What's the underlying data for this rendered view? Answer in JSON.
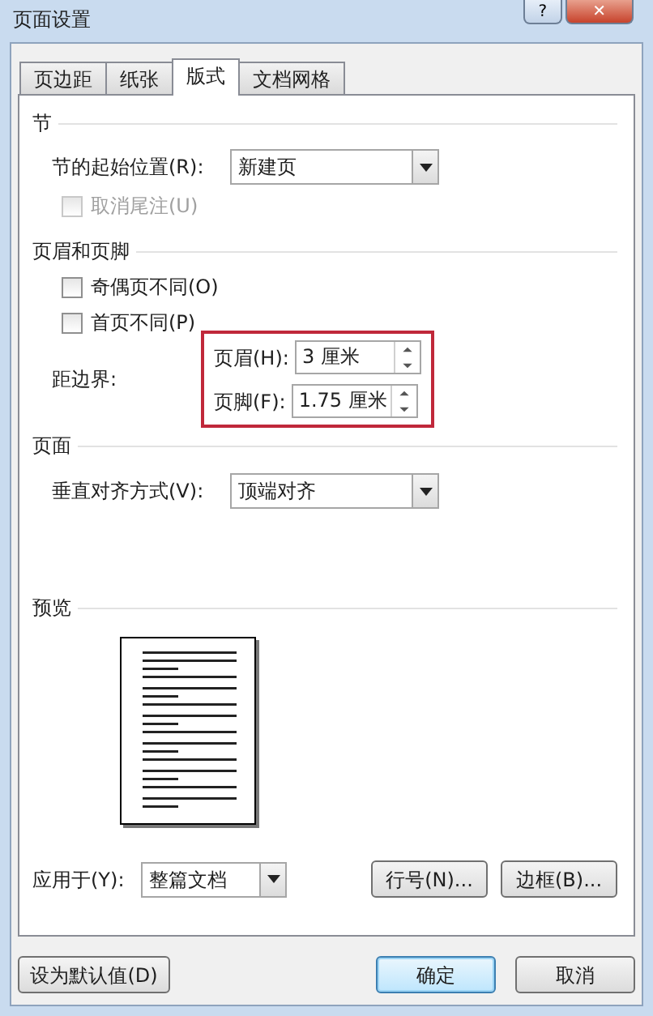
{
  "window": {
    "title": "页面设置",
    "buttons": [
      "?",
      "✕"
    ]
  },
  "tabs": [
    {
      "label": "页边距",
      "selected": false
    },
    {
      "label": "纸张",
      "selected": false
    },
    {
      "label": "版式",
      "selected": true
    },
    {
      "label": "文档网格",
      "selected": false
    }
  ],
  "section": {
    "heading": "节",
    "start_label": "节的起始位置(R):",
    "start_value": "新建页",
    "suppress_endnotes": {
      "label": "取消尾注(U)",
      "checked": false,
      "disabled": true
    }
  },
  "headers_footers": {
    "heading": "页眉和页脚",
    "options": [
      {
        "label": "奇偶页不同(O)",
        "checked": false,
        "disabled": false
      },
      {
        "label": "首页不同(P)",
        "checked": false,
        "disabled": false
      }
    ],
    "distance_label": "距边界:",
    "highlighted": true,
    "fields": [
      {
        "label": "页眉(H):",
        "value": "3 厘米"
      },
      {
        "label": "页脚(F):",
        "value": "1.75 厘米"
      }
    ]
  },
  "page": {
    "heading": "页面",
    "valign_label": "垂直对齐方式(V):",
    "valign_value": "顶端对齐"
  },
  "preview": {
    "heading": "预览"
  },
  "apply": {
    "label": "应用于(Y):",
    "value": "整篇文档",
    "buttons": [
      "行号(N)...",
      "边框(B)..."
    ]
  },
  "footer_buttons": [
    {
      "label": "设为默认值(D)",
      "kind": "plain"
    },
    {
      "label": "确定",
      "kind": "default"
    },
    {
      "label": "取消",
      "kind": "plain"
    }
  ]
}
